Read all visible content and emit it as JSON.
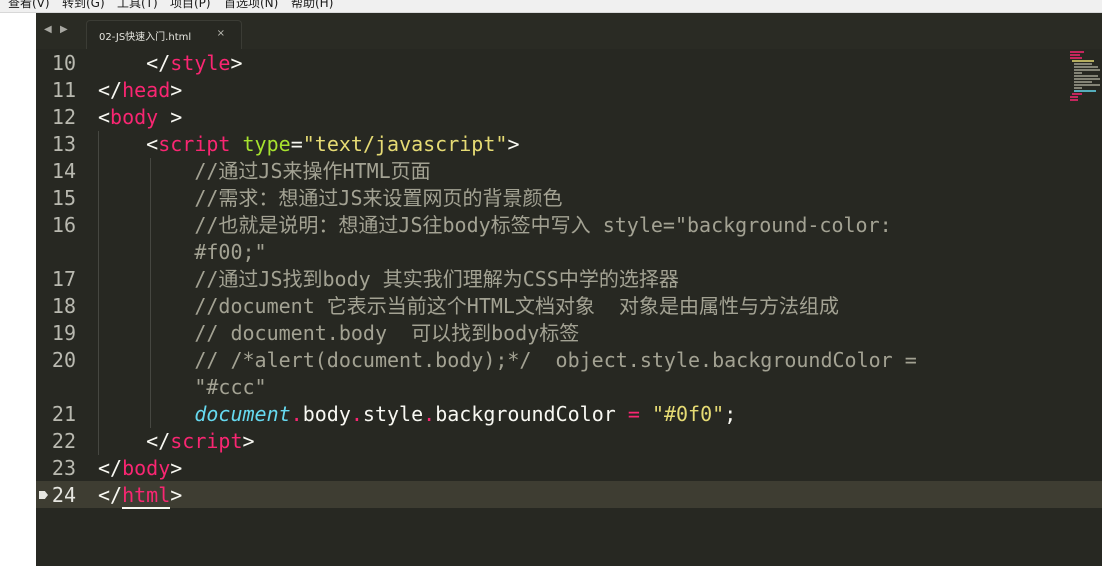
{
  "menu": [
    "查看(V)",
    "转到(G)",
    "工具(T)",
    "项目(P)",
    "首选项(N)",
    "帮助(H)"
  ],
  "tabbar": {
    "nav_left_icon": "chevron-left-icon",
    "nav_right_icon": "chevron-right-icon",
    "tab": {
      "label": "02-JS快速入门.html",
      "close_label": "×"
    }
  },
  "editor": {
    "line_numbers": [
      "10",
      "11",
      "12",
      "13",
      "14",
      "15",
      "16",
      "",
      "17",
      "18",
      "19",
      "20",
      "",
      "21",
      "22",
      "23",
      "24"
    ],
    "active_line": "24",
    "bookmark_icon": "bookmark-icon",
    "lines": [
      [
        {
          "t": "    </",
          "c": "plain"
        },
        {
          "t": "style",
          "c": "tag"
        },
        {
          "t": ">",
          "c": "plain"
        }
      ],
      [
        {
          "t": "</",
          "c": "plain"
        },
        {
          "t": "head",
          "c": "tag"
        },
        {
          "t": ">",
          "c": "plain"
        }
      ],
      [
        {
          "t": "<",
          "c": "plain"
        },
        {
          "t": "body",
          "c": "tag"
        },
        {
          "t": " >",
          "c": "plain"
        }
      ],
      [
        {
          "t": "    <",
          "c": "plain"
        },
        {
          "t": "script",
          "c": "tag"
        },
        {
          "t": " ",
          "c": "plain"
        },
        {
          "t": "type",
          "c": "attr"
        },
        {
          "t": "=",
          "c": "plain"
        },
        {
          "t": "\"text/javascript\"",
          "c": "str"
        },
        {
          "t": ">",
          "c": "plain"
        }
      ],
      [
        {
          "t": "        //通过JS来操作HTML页面",
          "c": "comment"
        }
      ],
      [
        {
          "t": "        //需求：想通过JS来设置网页的背景颜色",
          "c": "comment"
        }
      ],
      [
        {
          "t": "        //也就是说明：想通过JS往body标签中写入 style=\"background-color:",
          "c": "comment"
        }
      ],
      [
        {
          "t": "        #f00;\"",
          "c": "comment"
        }
      ],
      [
        {
          "t": "        //通过JS找到body 其实我们理解为CSS中学的选择器",
          "c": "comment"
        }
      ],
      [
        {
          "t": "        //document 它表示当前这个HTML文档对象  对象是由属性与方法组成",
          "c": "comment"
        }
      ],
      [
        {
          "t": "        // document.body  可以找到body标签",
          "c": "comment"
        }
      ],
      [
        {
          "t": "        // /*alert(document.body);*/  object.style.backgroundColor =",
          "c": "comment"
        }
      ],
      [
        {
          "t": "        \"#ccc\"",
          "c": "comment"
        }
      ],
      [
        {
          "t": "        ",
          "c": "plain"
        },
        {
          "t": "document",
          "c": "doc"
        },
        {
          "t": ".",
          "c": "dot"
        },
        {
          "t": "body",
          "c": "plain"
        },
        {
          "t": ".",
          "c": "dot"
        },
        {
          "t": "style",
          "c": "plain"
        },
        {
          "t": ".",
          "c": "dot"
        },
        {
          "t": "backgroundColor ",
          "c": "plain"
        },
        {
          "t": "=",
          "c": "tag"
        },
        {
          "t": " ",
          "c": "plain"
        },
        {
          "t": "\"#0f0\"",
          "c": "str"
        },
        {
          "t": ";",
          "c": "plain"
        }
      ],
      [
        {
          "t": "    </",
          "c": "plain"
        },
        {
          "t": "script",
          "c": "tag"
        },
        {
          "t": ">",
          "c": "plain"
        }
      ],
      [
        {
          "t": "</",
          "c": "plain"
        },
        {
          "t": "body",
          "c": "tag"
        },
        {
          "t": ">",
          "c": "plain"
        }
      ],
      [
        {
          "t": "</",
          "c": "plain"
        },
        {
          "t": "html",
          "c": "tag",
          "u": true
        },
        {
          "t": ">",
          "c": "plain"
        }
      ]
    ]
  },
  "colors": {
    "editor_bg": "#272822",
    "tag": "#f92672",
    "attr": "#a6e22e",
    "string": "#e6db74",
    "comment": "#a3a293",
    "keyword_doc": "#66d9ef"
  }
}
